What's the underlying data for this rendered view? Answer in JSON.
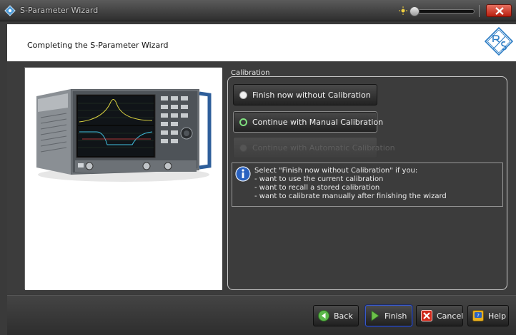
{
  "window": {
    "title": "S-Parameter Wizard"
  },
  "header": {
    "title": "Completing the S-Parameter Wizard"
  },
  "calibration": {
    "group_label": "Calibration",
    "options": [
      {
        "label": "Finish now without Calibration",
        "state": "checked"
      },
      {
        "label": "Continue with Manual Calibration",
        "state": "selected"
      },
      {
        "label": "Continue with Automatic Calibration",
        "state": "disabled"
      }
    ],
    "info": {
      "icon": "info-icon",
      "lines": [
        "Select \"Finish now without Calibration\" if you:",
        "- want to use the current calibration",
        "- want to recall a stored calibration",
        "- want to calibrate manually after finishing the wizard"
      ]
    }
  },
  "footer": {
    "back_label": "Back",
    "finish_label": "Finish",
    "cancel_label": "Cancel",
    "help_label": "Help"
  },
  "colors": {
    "accent_green": "#6cc24a",
    "cancel_red": "#c8201a",
    "help_yellow": "#e8b020",
    "focus_blue": "#3a5ac8"
  }
}
